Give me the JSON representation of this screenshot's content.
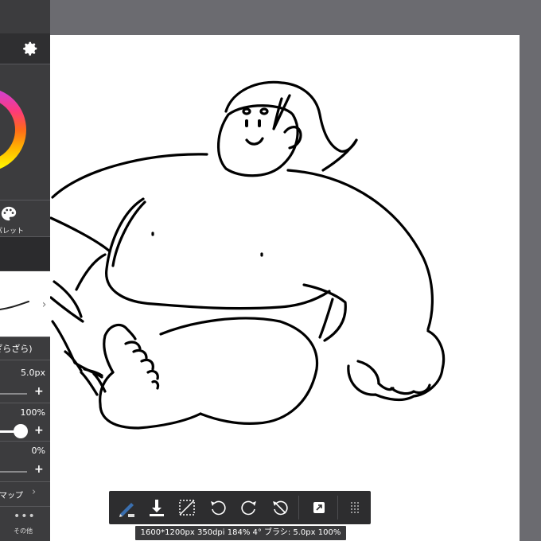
{
  "panel": {
    "palette_label": "パレット",
    "brush_name": "(ざらざら)",
    "brush_size": "5.0px",
    "brush_opacity": "100%",
    "brush_blur": "0%",
    "map_label": "マップ",
    "more_label": "その他"
  },
  "status": {
    "text": "1600*1200px 350dpi 184% 4° ブラシ: 5.0px 100%"
  },
  "toolbar": {
    "buttons": [
      "pen-eraser-icon",
      "download-icon",
      "no-selection-icon",
      "undo-icon",
      "redo-icon",
      "rotate-reset-icon",
      "transform-icon",
      "grid-icon"
    ]
  }
}
